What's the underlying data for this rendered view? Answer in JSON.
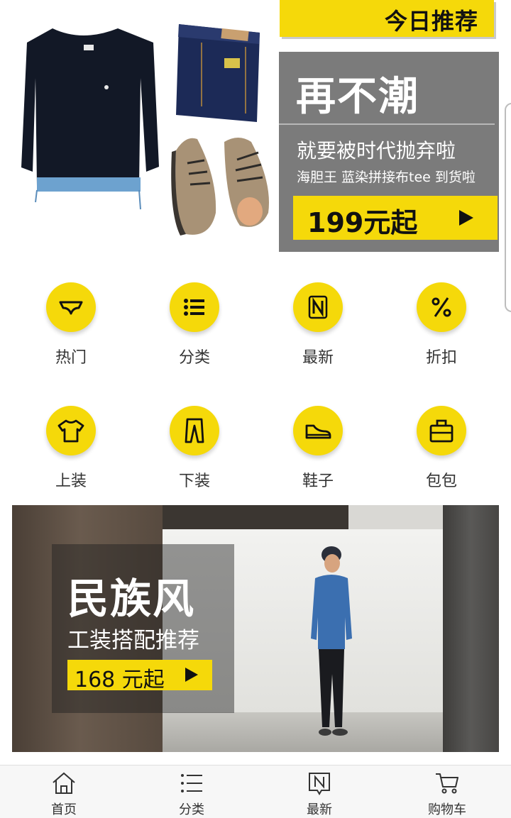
{
  "hero": {
    "today_tag": "今日推荐",
    "promo_title": "再不潮",
    "promo_subtitle": "就要被时代抛弃啦",
    "promo_small": "海胆王 蓝染拼接布tee 到货啦",
    "promo_price": "199元起"
  },
  "categories": [
    {
      "label": "热门",
      "icon": "underwear-icon"
    },
    {
      "label": "分类",
      "icon": "list-icon"
    },
    {
      "label": "最新",
      "icon": "new-n-icon"
    },
    {
      "label": "折扣",
      "icon": "percent-icon"
    },
    {
      "label": "上装",
      "icon": "tshirt-icon"
    },
    {
      "label": "下装",
      "icon": "pants-icon"
    },
    {
      "label": "鞋子",
      "icon": "shoe-icon"
    },
    {
      "label": "包包",
      "icon": "bag-icon"
    }
  ],
  "banner2": {
    "title": "民族风",
    "subtitle": "工装搭配推荐",
    "price": "168 元起"
  },
  "bottom_nav": [
    {
      "label": "首页",
      "icon": "home-icon"
    },
    {
      "label": "分类",
      "icon": "list-icon"
    },
    {
      "label": "最新",
      "icon": "new-n-icon"
    },
    {
      "label": "购物车",
      "icon": "cart-icon"
    }
  ],
  "colors": {
    "accent": "#f5d90a",
    "promo_gray": "#7b7b7b",
    "text": "#333333"
  }
}
